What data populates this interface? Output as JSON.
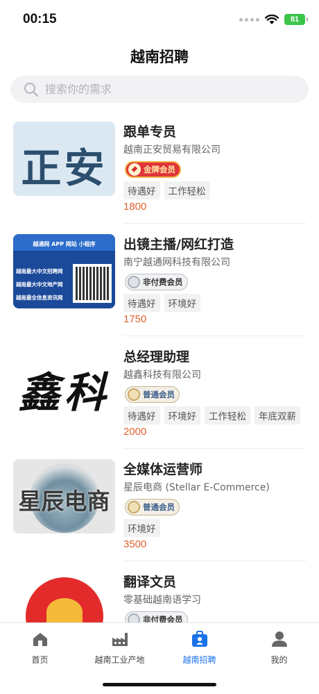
{
  "status_bar": {
    "time": "00:15",
    "battery": "81"
  },
  "header": {
    "title": "越南招聘"
  },
  "search": {
    "placeholder": "搜索你的需求"
  },
  "jobs": [
    {
      "title": "跟单专员",
      "company": "越南正安贸易有限公司",
      "badge": "金牌会员",
      "badge_type": "gold",
      "tags": [
        "待遇好",
        "工作轻松"
      ],
      "salary": "1800",
      "logo_text": "正安"
    },
    {
      "title": "出镜主播/网红打造",
      "company": "南宁越通网科技有限公司",
      "badge": "非付费会员",
      "badge_type": "silver",
      "tags": [
        "待遇好",
        "环境好"
      ],
      "salary": "1750",
      "logo_text": {
        "top": "越通网 APP 网站 小程序",
        "line1": "越南最大中文招聘网",
        "line2": "越南最大中文地产网",
        "line3": "越南最全信息资讯网"
      }
    },
    {
      "title": "总经理助理",
      "company": "越鑫科技有限公司",
      "badge": "普通会员",
      "badge_type": "normal",
      "tags": [
        "待遇好",
        "环境好",
        "工作轻松",
        "年底双薪"
      ],
      "salary": "2000",
      "logo_text": "鑫科"
    },
    {
      "title": "全媒体运营师",
      "company": "星辰电商 (Stellar E-Commerce)",
      "badge": "普通会员",
      "badge_type": "normal",
      "tags": [
        "环境好"
      ],
      "salary": "3500",
      "logo_text": "星辰电商"
    },
    {
      "title": "翻译文员",
      "company": "零基础越南语学习",
      "badge": "非付费会员",
      "badge_type": "silver",
      "tags": [],
      "salary": "",
      "logo_text": ""
    }
  ],
  "tabbar": {
    "items": [
      {
        "label": "首页",
        "icon": "home-icon"
      },
      {
        "label": "越南工业产地",
        "icon": "factory-icon"
      },
      {
        "label": "越南招聘",
        "icon": "briefcase-icon",
        "active": true
      },
      {
        "label": "我的",
        "icon": "user-icon"
      }
    ],
    "active_color": "#1a73e8"
  }
}
